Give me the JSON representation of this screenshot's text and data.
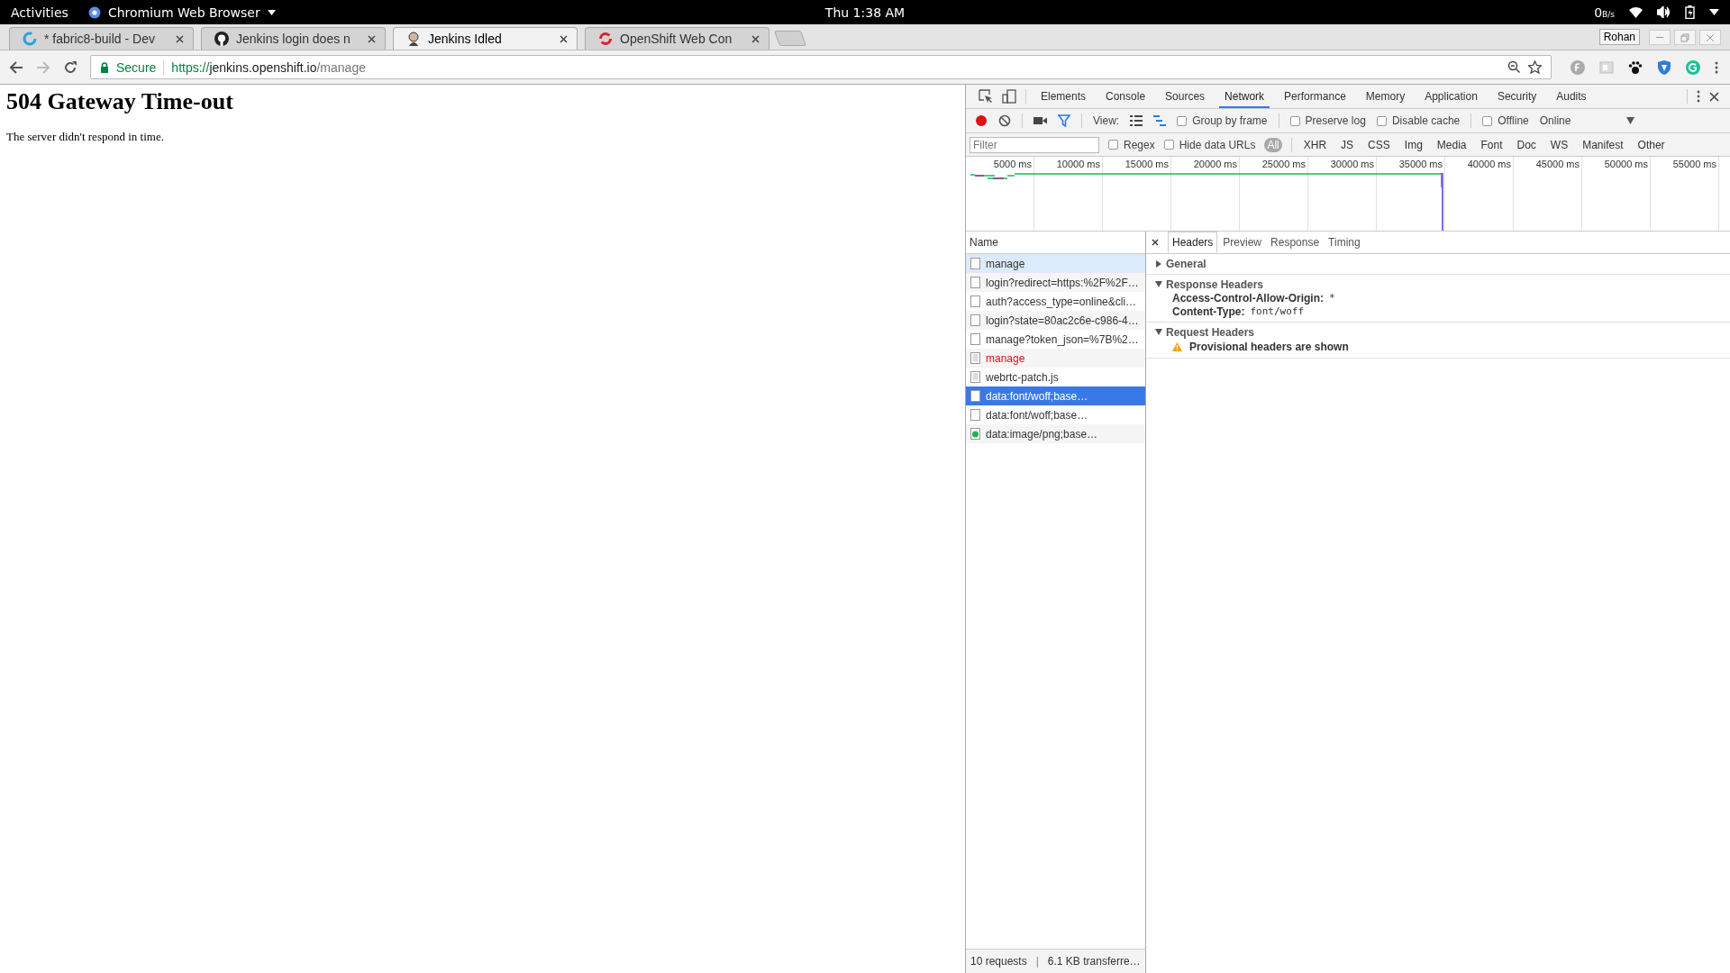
{
  "system_bar": {
    "activities": "Activities",
    "app_name": "Chromium Web Browser",
    "clock": "Thu  1:38 AM",
    "net_speed": "0",
    "net_unit": "B/s"
  },
  "browser_tabs": [
    {
      "title": "* fabric8-build - Dev",
      "kind": "fabric8",
      "selected": false
    },
    {
      "title": "Jenkins login does n",
      "kind": "github",
      "selected": false
    },
    {
      "title": "Jenkins Idled",
      "kind": "jenkins",
      "selected": true
    },
    {
      "title": "OpenShift Web Con",
      "kind": "openshift",
      "selected": false
    }
  ],
  "profile": "Rohan",
  "address_bar": {
    "secure_label": "Secure",
    "scheme": "https://",
    "host": "jenkins.openshift.io",
    "path": "/manage"
  },
  "page": {
    "heading": "504 Gateway Time-out",
    "message": "The server didn't respond in time."
  },
  "devtools": {
    "tabs": [
      {
        "label": "Elements",
        "selected": false
      },
      {
        "label": "Console",
        "selected": false
      },
      {
        "label": "Sources",
        "selected": false
      },
      {
        "label": "Network",
        "selected": true
      },
      {
        "label": "Performance",
        "selected": false
      },
      {
        "label": "Memory",
        "selected": false
      },
      {
        "label": "Application",
        "selected": false
      },
      {
        "label": "Security",
        "selected": false
      },
      {
        "label": "Audits",
        "selected": false
      }
    ],
    "view_label": "View:",
    "options": [
      {
        "label": "Group by frame",
        "checked": false
      },
      {
        "label": "Preserve log",
        "checked": false
      },
      {
        "label": "Disable cache",
        "checked": false
      },
      {
        "label": "Offline",
        "checked": false
      }
    ],
    "throttling": "Online",
    "filter_placeholder": "Filter",
    "filter_options": [
      {
        "label": "Regex",
        "checked": false
      },
      {
        "label": "Hide data URLs",
        "checked": false
      }
    ],
    "types": [
      {
        "label": "All",
        "selected": true
      },
      {
        "label": "XHR",
        "selected": false
      },
      {
        "label": "JS",
        "selected": false
      },
      {
        "label": "CSS",
        "selected": false
      },
      {
        "label": "Img",
        "selected": false
      },
      {
        "label": "Media",
        "selected": false
      },
      {
        "label": "Font",
        "selected": false
      },
      {
        "label": "Doc",
        "selected": false
      },
      {
        "label": "WS",
        "selected": false
      },
      {
        "label": "Manifest",
        "selected": false
      },
      {
        "label": "Other",
        "selected": false
      }
    ],
    "ticks": [
      "5000 ms",
      "10000 ms",
      "15000 ms",
      "20000 ms",
      "25000 ms",
      "30000 ms",
      "35000 ms",
      "40000 ms",
      "45000 ms",
      "50000 ms",
      "55000 ms"
    ],
    "name_header": "Name",
    "requests": [
      {
        "name": "manage",
        "kind": "document",
        "selected": false,
        "hovered": true,
        "failed": false
      },
      {
        "name": "login?redirect=https:%2F%2F…",
        "kind": "document",
        "selected": false,
        "hovered": false,
        "failed": false
      },
      {
        "name": "auth?access_type=online&cli…",
        "kind": "document",
        "selected": false,
        "hovered": false,
        "failed": false
      },
      {
        "name": "login?state=80ac2c6e-c986-4…",
        "kind": "document",
        "selected": false,
        "hovered": false,
        "failed": false
      },
      {
        "name": "manage?token_json=%7B%2…",
        "kind": "document",
        "selected": false,
        "hovered": false,
        "failed": false
      },
      {
        "name": "manage",
        "kind": "script",
        "selected": false,
        "hovered": false,
        "failed": true
      },
      {
        "name": "webrtc-patch.js",
        "kind": "script",
        "selected": false,
        "hovered": false,
        "failed": false
      },
      {
        "name": "data:font/woff;base…",
        "kind": "document",
        "selected": true,
        "hovered": false,
        "failed": false
      },
      {
        "name": "data:font/woff;base…",
        "kind": "document",
        "selected": false,
        "hovered": false,
        "failed": false
      },
      {
        "name": "data:image/png;base…",
        "kind": "image",
        "selected": false,
        "hovered": false,
        "failed": false
      }
    ],
    "detail_tabs": [
      {
        "label": "Headers",
        "selected": true
      },
      {
        "label": "Preview",
        "selected": false
      },
      {
        "label": "Response",
        "selected": false
      },
      {
        "label": "Timing",
        "selected": false
      }
    ],
    "sections": [
      {
        "title": "General",
        "expanded": false
      },
      {
        "title": "Response Headers",
        "expanded": true,
        "headers": [
          {
            "name": "Access-Control-Allow-Origin:",
            "value": "*"
          },
          {
            "name": "Content-Type:",
            "value": "font/woff"
          }
        ]
      },
      {
        "title": "Request Headers",
        "expanded": true,
        "warning": "Provisional headers are shown"
      }
    ],
    "status": {
      "requests": "10 requests",
      "separator": "|",
      "transferred": "6.1 KB transferre…"
    }
  }
}
